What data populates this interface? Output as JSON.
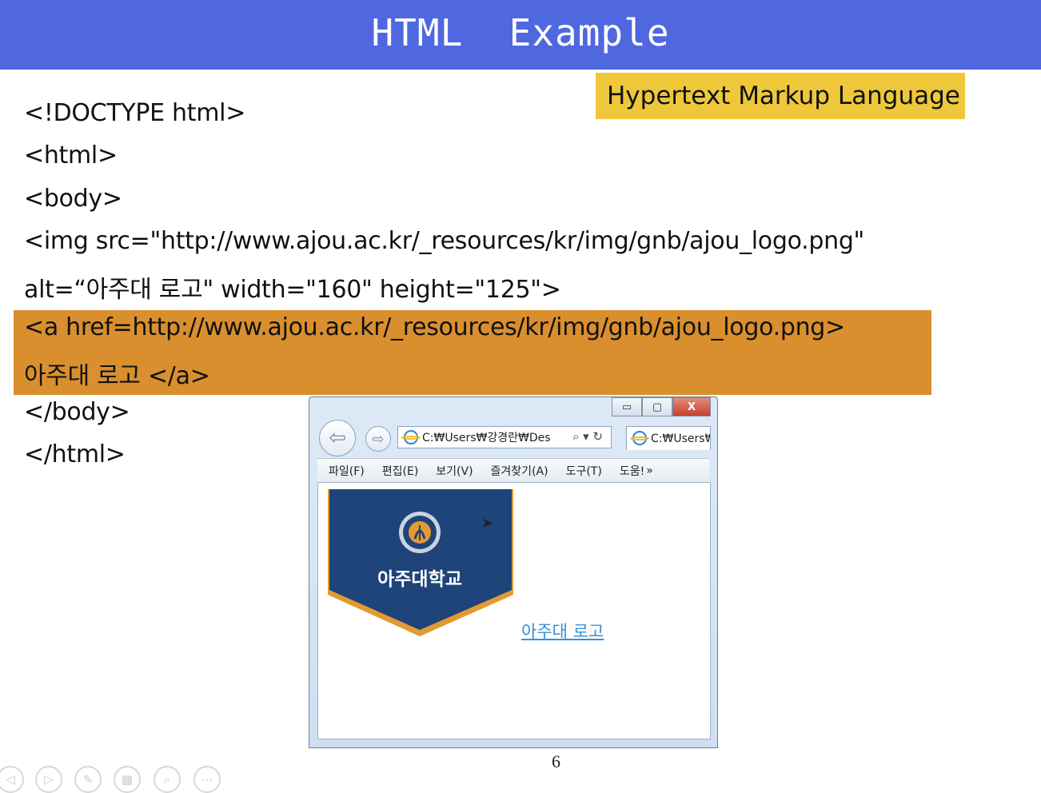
{
  "slide": {
    "title": "HTML  Example",
    "callout": "Hypertext Markup Language",
    "code_lines": [
      "<!DOCTYPE html>",
      "<html>",
      "<body>",
      "<img src=\"http://www.ajou.ac.kr/_resources/kr/img/gnb/ajou_logo.png\"",
      "alt=“아주대 로고\" width=\"160\" height=\"125\">",
      "<a href=http://www.ajou.ac.kr/_resources/kr/img/gnb/ajou_logo.png>",
      "아주대 로고 </a>",
      "</body>",
      "</html>"
    ],
    "page_number": "6"
  },
  "browser": {
    "window_buttons": {
      "minimize": "▭",
      "maximize": "▢",
      "close": "X"
    },
    "address": "C:₩Users₩강경란₩Des",
    "tab_title": "C:₩Users₩",
    "menu": [
      "파일(F)",
      "편집(E)",
      "보기(V)",
      "즐겨찾기(A)",
      "도구(T)",
      "도움!",
      "»"
    ],
    "logo_text": "아주대학교",
    "link_text": "아주대 로고"
  },
  "colors": {
    "title_bar": "#4f68e0",
    "callout": "#eec73a",
    "highlight": "#d98f2e",
    "logo_navy": "#1e4479",
    "logo_orange": "#e29a32",
    "link": "#3a8fd6"
  },
  "slideshow_controls": [
    "prev-icon",
    "next-icon",
    "pen-icon",
    "slides-icon",
    "zoom-icon",
    "more-icon"
  ]
}
